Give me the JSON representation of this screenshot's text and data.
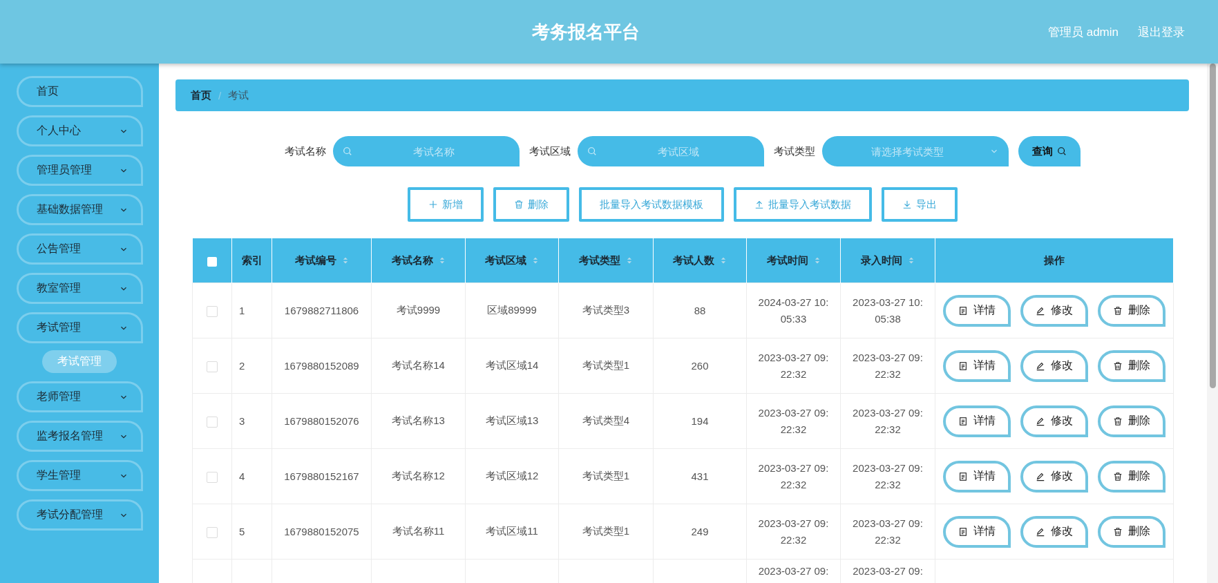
{
  "header": {
    "title": "考务报名平台",
    "user": "管理员 admin",
    "logout": "退出登录"
  },
  "sidebar": {
    "items": [
      {
        "label": "首页",
        "kind": "link"
      },
      {
        "label": "个人中心",
        "kind": "submenu"
      },
      {
        "label": "管理员管理",
        "kind": "submenu"
      },
      {
        "label": "基础数据管理",
        "kind": "submenu"
      },
      {
        "label": "公告管理",
        "kind": "submenu"
      },
      {
        "label": "教室管理",
        "kind": "submenu"
      },
      {
        "label": "考试管理",
        "kind": "submenu",
        "children": [
          {
            "label": "考试管理",
            "selected": true
          }
        ]
      },
      {
        "label": "老师管理",
        "kind": "submenu"
      },
      {
        "label": "监考报名管理",
        "kind": "submenu"
      },
      {
        "label": "学生管理",
        "kind": "submenu"
      },
      {
        "label": "考试分配管理",
        "kind": "submenu"
      }
    ]
  },
  "breadcrumb": {
    "separator": "/",
    "items": [
      {
        "label": "首页",
        "current": false
      },
      {
        "label": "考试",
        "current": true
      }
    ]
  },
  "search": {
    "fields": [
      {
        "label": "考试名称",
        "placeholder": "考试名称",
        "kind": "input"
      },
      {
        "label": "考试区域",
        "placeholder": "考试区域",
        "kind": "input"
      },
      {
        "label": "考试类型",
        "placeholder": "请选择考试类型",
        "kind": "select"
      }
    ],
    "query_button": "查询"
  },
  "actions": [
    {
      "kind": "add",
      "label": "新增"
    },
    {
      "kind": "delete",
      "label": "删除"
    },
    {
      "kind": "template",
      "label": "批量导入考试数据模板"
    },
    {
      "kind": "import",
      "label": "批量导入考试数据"
    },
    {
      "kind": "export",
      "label": "导出"
    }
  ],
  "table": {
    "select_all": {
      "checked": false
    },
    "columns": [
      {
        "label": "索引",
        "sortable": false
      },
      {
        "label": "考试编号",
        "sortable": true
      },
      {
        "label": "考试名称",
        "sortable": true
      },
      {
        "label": "考试区域",
        "sortable": true
      },
      {
        "label": "考试类型",
        "sortable": true
      },
      {
        "label": "考试人数",
        "sortable": true
      },
      {
        "label": "考试时间",
        "sortable": true
      },
      {
        "label": "录入时间",
        "sortable": true
      },
      {
        "label": "操作",
        "sortable": false
      }
    ],
    "rows": [
      {
        "checked": false,
        "cells": [
          "1",
          "1679882711806",
          "考试9999",
          "区域89999",
          "考试类型3",
          "88",
          "2024-03-27 10:05:33",
          "2023-03-27 10:05:38"
        ],
        "actions": [
          {
            "kind": "detail",
            "label": "详情"
          },
          {
            "kind": "edit",
            "label": "修改"
          },
          {
            "kind": "delete",
            "label": "删除"
          }
        ]
      },
      {
        "checked": false,
        "cells": [
          "2",
          "1679880152089",
          "考试名称14",
          "考试区域14",
          "考试类型1",
          "260",
          "2023-03-27 09:22:32",
          "2023-03-27 09:22:32"
        ],
        "actions": [
          {
            "kind": "detail",
            "label": "详情"
          },
          {
            "kind": "edit",
            "label": "修改"
          },
          {
            "kind": "delete",
            "label": "删除"
          }
        ]
      },
      {
        "checked": false,
        "cells": [
          "3",
          "1679880152076",
          "考试名称13",
          "考试区域13",
          "考试类型4",
          "194",
          "2023-03-27 09:22:32",
          "2023-03-27 09:22:32"
        ],
        "actions": [
          {
            "kind": "detail",
            "label": "详情"
          },
          {
            "kind": "edit",
            "label": "修改"
          },
          {
            "kind": "delete",
            "label": "删除"
          }
        ]
      },
      {
        "checked": false,
        "cells": [
          "4",
          "1679880152167",
          "考试名称12",
          "考试区域12",
          "考试类型1",
          "431",
          "2023-03-27 09:22:32",
          "2023-03-27 09:22:32"
        ],
        "actions": [
          {
            "kind": "detail",
            "label": "详情"
          },
          {
            "kind": "edit",
            "label": "修改"
          },
          {
            "kind": "delete",
            "label": "删除"
          }
        ]
      },
      {
        "checked": false,
        "cells": [
          "5",
          "1679880152075",
          "考试名称11",
          "考试区域11",
          "考试类型1",
          "249",
          "2023-03-27 09:22:32",
          "2023-03-27 09:22:32"
        ],
        "actions": [
          {
            "kind": "detail",
            "label": "详情"
          },
          {
            "kind": "edit",
            "label": "修改"
          },
          {
            "kind": "delete",
            "label": "删除"
          }
        ]
      }
    ],
    "cut_row": {
      "exam_time": "2023-03-27 09:",
      "entry_time": "2023-03-27 09:"
    }
  }
}
